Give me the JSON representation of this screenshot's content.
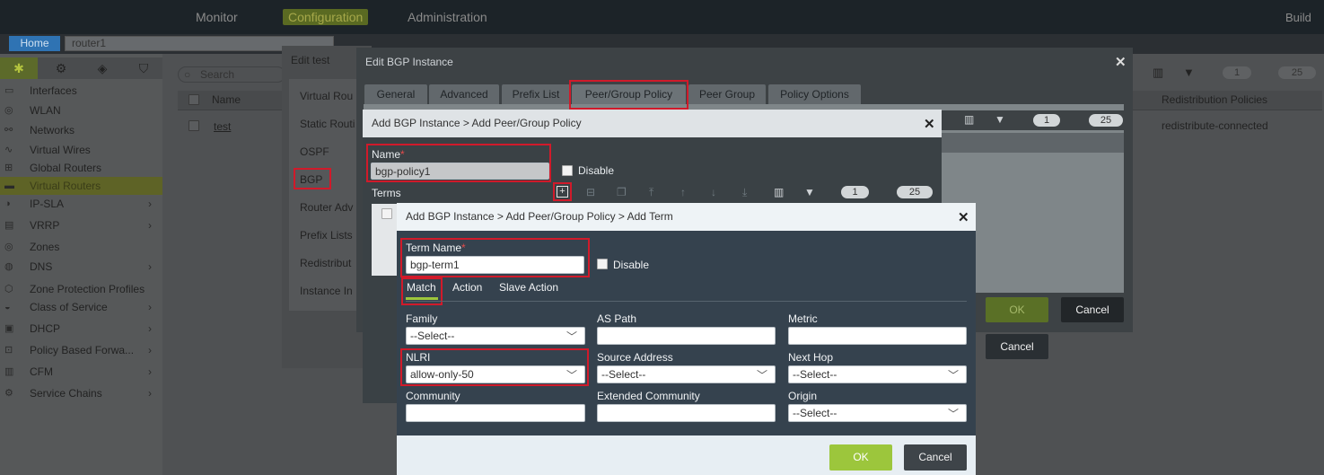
{
  "top_nav": {
    "items": [
      "Monitor",
      "Configuration",
      "Administration"
    ],
    "right_label": "Build"
  },
  "breadcrumb": {
    "home": "Home",
    "router": "router1"
  },
  "sidebar": {
    "items": [
      {
        "label": "Interfaces"
      },
      {
        "label": "WLAN"
      },
      {
        "label": "Networks"
      },
      {
        "label": "Virtual Wires"
      },
      {
        "label": "Global Routers"
      },
      {
        "label": "Virtual Routers",
        "active": true
      },
      {
        "label": "IP-SLA",
        "expandable": true
      },
      {
        "label": "VRRP",
        "expandable": true
      },
      {
        "label": "Zones"
      },
      {
        "label": "DNS",
        "expandable": true
      },
      {
        "label": "Zone Protection Profiles"
      },
      {
        "label": "Class of Service",
        "expandable": true
      },
      {
        "label": "DHCP",
        "expandable": true
      },
      {
        "label": "Policy Based Forwa...",
        "expandable": true
      },
      {
        "label": "CFM",
        "expandable": true
      },
      {
        "label": "Service Chains",
        "expandable": true
      }
    ]
  },
  "main_grid": {
    "search_placeholder": "Search",
    "col_name": "Name",
    "row_name": "test",
    "col_redistribution": "Redistribution Policies",
    "row_redistribution": "redistribute-connected",
    "page": "1",
    "page_size": "25"
  },
  "edit_test": {
    "title": "Edit test",
    "items": [
      "Virtual Rou",
      "Static Routi",
      "OSPF",
      "BGP",
      "Router Adv",
      "Prefix Lists",
      "Redistribut",
      "Instance In"
    ]
  },
  "edit_bgp": {
    "title": "Edit BGP Instance",
    "tabs": [
      "General",
      "Advanced",
      "Prefix List",
      "Peer/Group Policy",
      "Peer Group",
      "Policy Options"
    ],
    "ok": "OK",
    "cancel": "Cancel",
    "page": "1",
    "page_size": "25"
  },
  "add_policy": {
    "title": "Add BGP Instance > Add Peer/Group Policy",
    "name_label": "Name",
    "name_value": "bgp-policy1",
    "disable_label": "Disable",
    "terms_label": "Terms",
    "page": "1",
    "page_size": "25",
    "cancel": "Cancel"
  },
  "add_term": {
    "title": "Add BGP Instance > Add Peer/Group Policy > Add Term",
    "term_name_label": "Term Name",
    "term_name_value": "bgp-term1",
    "disable_label": "Disable",
    "tabs": [
      "Match",
      "Action",
      "Slave Action"
    ],
    "fields": {
      "family": {
        "label": "Family",
        "value": "--Select--"
      },
      "as_path": {
        "label": "AS Path",
        "value": ""
      },
      "metric": {
        "label": "Metric",
        "value": ""
      },
      "nlri": {
        "label": "NLRI",
        "value": "allow-only-50"
      },
      "source_address": {
        "label": "Source Address",
        "value": "--Select--"
      },
      "next_hop": {
        "label": "Next Hop",
        "value": "--Select--"
      },
      "community": {
        "label": "Community",
        "value": ""
      },
      "extended_community": {
        "label": "Extended Community",
        "value": ""
      },
      "origin": {
        "label": "Origin",
        "value": "--Select--"
      }
    },
    "ok": "OK",
    "cancel": "Cancel"
  },
  "colors": {
    "accent_green": "#9cc63c",
    "highlight_red": "#d11a2a",
    "dialog_blue": "#35424e"
  }
}
